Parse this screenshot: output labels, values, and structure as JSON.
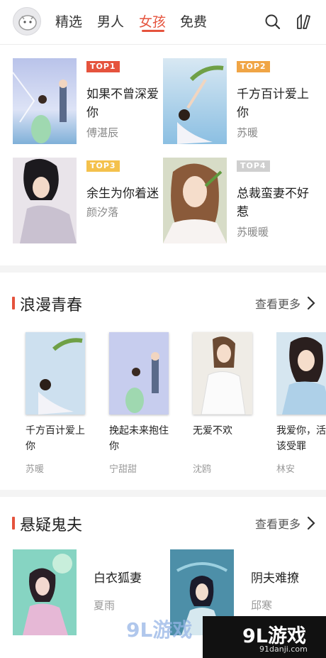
{
  "tabs": [
    {
      "label": "精选"
    },
    {
      "label": "男人"
    },
    {
      "label": "女孩"
    },
    {
      "label": "免费"
    }
  ],
  "active_tab_index": 2,
  "icons": {
    "search": "search-icon",
    "book": "library-icon",
    "avatar": "avatar-icon"
  },
  "accent_color": "#e5533d",
  "ranking": [
    {
      "badge": "TOP1",
      "badge_color": "#e5533d",
      "title": "如果不曾深爱你",
      "author": "傅湛辰"
    },
    {
      "badge": "TOP2",
      "badge_color": "#f0a545",
      "title": "千方百计爱上你",
      "author": "苏暖"
    },
    {
      "badge": "TOP3",
      "badge_color": "#f4c14c",
      "title": "余生为你着迷",
      "author": "颜汐落"
    },
    {
      "badge": "TOP4",
      "badge_color": "#cfcfcf",
      "title": "总裁蛮妻不好惹",
      "author": "苏暖暖"
    }
  ],
  "section_romance": {
    "title": "浪漫青春",
    "more": "查看更多",
    "books": [
      {
        "title": "千方百计爱上你",
        "author": "苏暖"
      },
      {
        "title": "挽起未来抱住你",
        "author": "宁甜甜"
      },
      {
        "title": "无爱不欢",
        "author": "沈鸥"
      },
      {
        "title": "我爱你，活该受罪",
        "author": "林安"
      }
    ]
  },
  "section_suspense": {
    "title": "悬疑鬼夫",
    "more": "查看更多",
    "books": [
      {
        "title": "白衣狐妻",
        "author": "夏雨"
      },
      {
        "title": "阴夫难撩",
        "author": "邱寒"
      }
    ]
  },
  "watermark": {
    "logo_text": "9L游戏",
    "site": "91danji.com"
  }
}
